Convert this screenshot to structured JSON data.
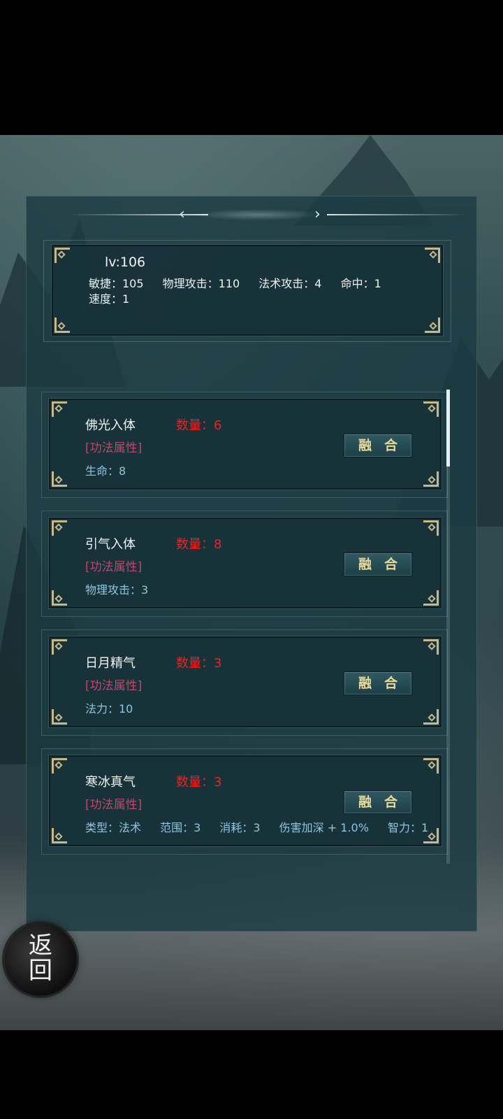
{
  "player": {
    "level": "lv:106",
    "stats_row1": [
      "敏捷：105",
      "物理攻击：110",
      "法术攻击：4",
      "命中：1"
    ],
    "stats_row2": [
      "速度：1"
    ]
  },
  "skills": [
    {
      "name": "佛光入体",
      "qty_label": "数量：",
      "qty": "6",
      "attr": "[功法属性]",
      "effects": [
        "生命：8"
      ],
      "button": "融合"
    },
    {
      "name": "引气入体",
      "qty_label": "数量：",
      "qty": "8",
      "attr": "[功法属性]",
      "effects": [
        "物理攻击：3"
      ],
      "button": "融合"
    },
    {
      "name": "日月精气",
      "qty_label": "数量：",
      "qty": "3",
      "attr": "[功法属性]",
      "effects": [
        "法力：10"
      ],
      "button": "融合"
    },
    {
      "name": "寒冰真气",
      "qty_label": "数量：",
      "qty": "3",
      "attr": "[功法属性]",
      "effects": [
        "类型：法术",
        "范围：3",
        "消耗：3",
        "伤害加深 + 1.0%",
        "智力：1"
      ],
      "button": "融合"
    }
  ],
  "nav": {
    "prev_arrow": "‹",
    "next_arrow": "›",
    "back_line1": "返",
    "back_line2": "回"
  },
  "colors": {
    "quantity": "#e32626",
    "attr_tag": "#c4456c",
    "effect": "#8fc6dd",
    "button_text": "#e8d89a"
  }
}
